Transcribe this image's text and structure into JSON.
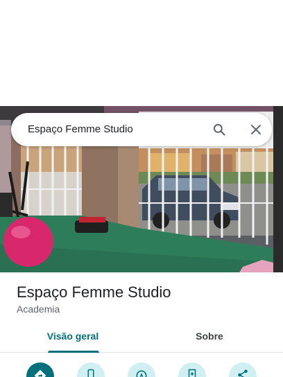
{
  "search": {
    "query": "Espaço Femme Studio"
  },
  "photo": {
    "description_icon": "photo"
  },
  "place": {
    "name": "Espaço Femme Studio",
    "category": "Academia"
  },
  "tabs": [
    {
      "label": "Visão geral",
      "selected": true
    },
    {
      "label": "Sobre",
      "selected": false
    }
  ],
  "colors": {
    "accent": "#00707a",
    "action_bg": "#cfeff2",
    "text_primary": "#202124",
    "text_secondary": "#5f6368"
  },
  "actions": [
    {
      "icon": "directions-icon"
    },
    {
      "icon": "phone-icon"
    },
    {
      "icon": "navigation-icon"
    },
    {
      "icon": "save-icon"
    },
    {
      "icon": "share-icon"
    }
  ]
}
